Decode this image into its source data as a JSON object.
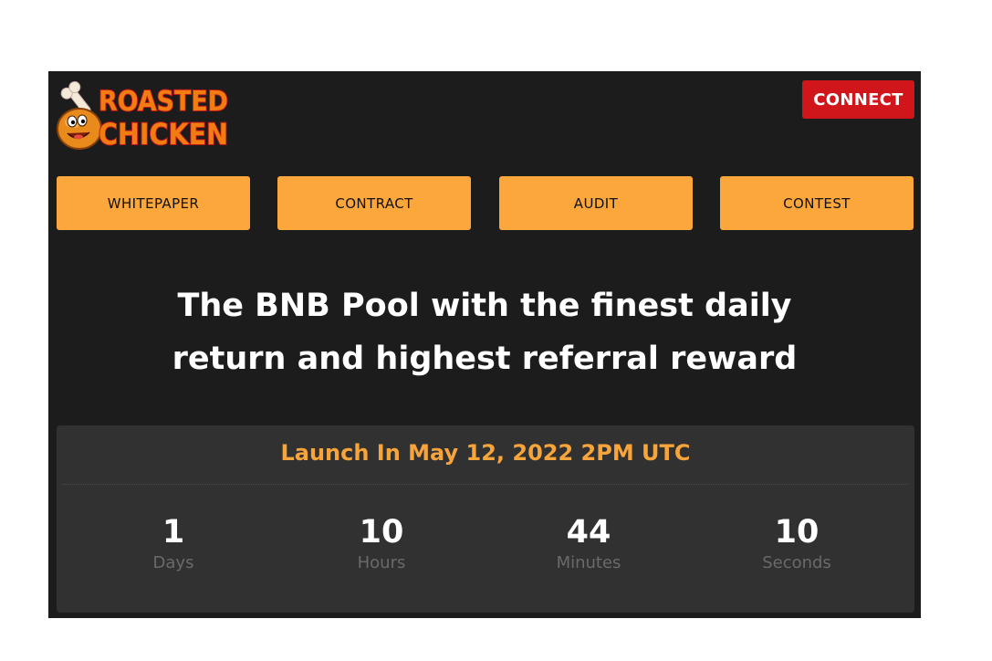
{
  "brand": {
    "logo_line1": "ROASTED",
    "logo_line2": "CHICKEN",
    "logo_icon": "chicken-drumstick-mascot-icon",
    "accent": "#fba73c",
    "logo_text_color": "#f07c12",
    "logo_outline_color": "#c0141a"
  },
  "header": {
    "connect_label": "CONNECT",
    "connect_color": "#d0161b"
  },
  "nav": {
    "items": [
      {
        "label": "WHITEPAPER"
      },
      {
        "label": "CONTRACT"
      },
      {
        "label": "AUDIT"
      },
      {
        "label": "CONTEST"
      }
    ]
  },
  "hero": {
    "line1": "The BNB Pool with the finest daily",
    "line2": "return and highest referral reward"
  },
  "countdown": {
    "launch_text": "Launch In May 12, 2022 2PM UTC",
    "units": [
      {
        "value": "1",
        "label": "Days"
      },
      {
        "value": "10",
        "label": "Hours"
      },
      {
        "value": "44",
        "label": "Minutes"
      },
      {
        "value": "10",
        "label": "Seconds"
      }
    ]
  },
  "colors": {
    "background": "#1c1c1c",
    "panel": "#313131",
    "launch_text": "#f7a43b",
    "unit_label": "#6a6a6a"
  }
}
